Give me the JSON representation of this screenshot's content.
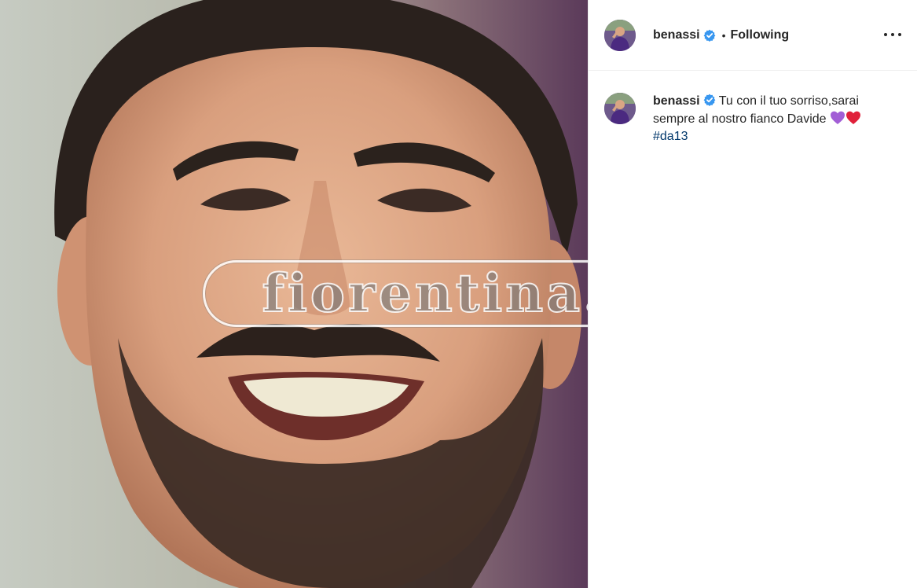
{
  "post": {
    "photo": {
      "alt_icon": "portrait-photo",
      "watermark": "fiorentina.it"
    },
    "header": {
      "username": "benassi",
      "separator": "•",
      "follow_status": "Following",
      "avatar_icon": "profile-avatar",
      "verified_icon": "verified-badge-icon",
      "more_icon": "more-options-icon"
    },
    "caption": {
      "username": "benassi",
      "text": "Tu con il tuo sorriso,sarai sempre al nostro fianco Davide",
      "emojis": [
        "purple-heart",
        "red-heart"
      ],
      "hashtag": "#da13"
    }
  },
  "colors": {
    "verified": "#3897f0",
    "hashtag": "#00376b",
    "text": "#262626",
    "divider": "#efefef",
    "purple_heart": "#a25ed6",
    "red_heart": "#e0203a"
  }
}
